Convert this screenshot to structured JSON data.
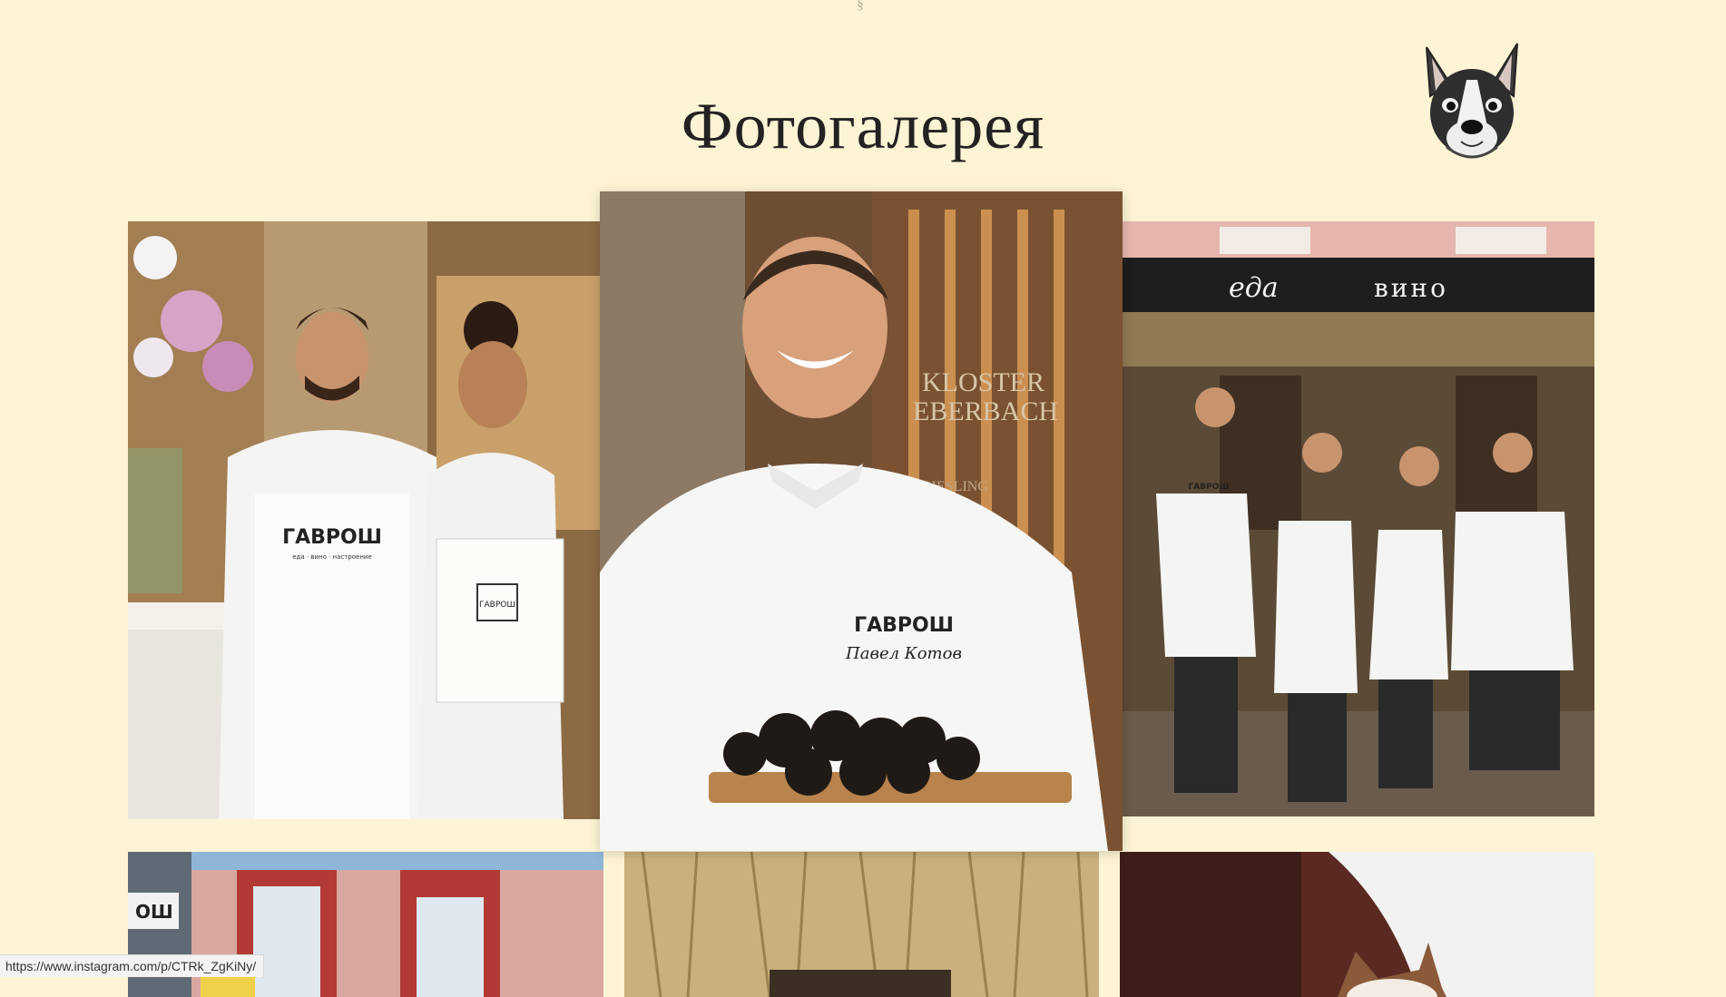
{
  "page": {
    "top_mark": "§",
    "title": "Фотогалерея",
    "logo_icon": "french-bulldog-logo-icon"
  },
  "gallery": {
    "items": [
      {
        "name": "photo-waiters-bistro",
        "aprons_text": "ГАВРОШ",
        "apron_sub": "еда · вино · настроение",
        "menu_text": "ГАВРОШ"
      },
      {
        "name": "photo-chef-truffles",
        "chef_jacket_brand": "ГАВРОШ",
        "chef_name": "Павел Котов",
        "wall_text_1": "KLOSTER",
        "wall_text_2": "EBERBACH",
        "wall_text_3": "RIESLING"
      },
      {
        "name": "photo-team-terrace",
        "awning_word_1": "еда",
        "awning_word_2": "вино",
        "apron_text": "ГАВРОШ"
      },
      {
        "name": "photo-building-facade",
        "sign_text": "ОШ"
      },
      {
        "name": "photo-straw-decor"
      },
      {
        "name": "photo-bulldog"
      }
    ]
  },
  "status_bar": {
    "url": "https://www.instagram.com/p/CTRk_ZgKiNy/"
  },
  "colors": {
    "background": "#fcf4d4",
    "title": "#222222",
    "awning": "#1e1e1e",
    "apron": "#f4f4f2"
  }
}
